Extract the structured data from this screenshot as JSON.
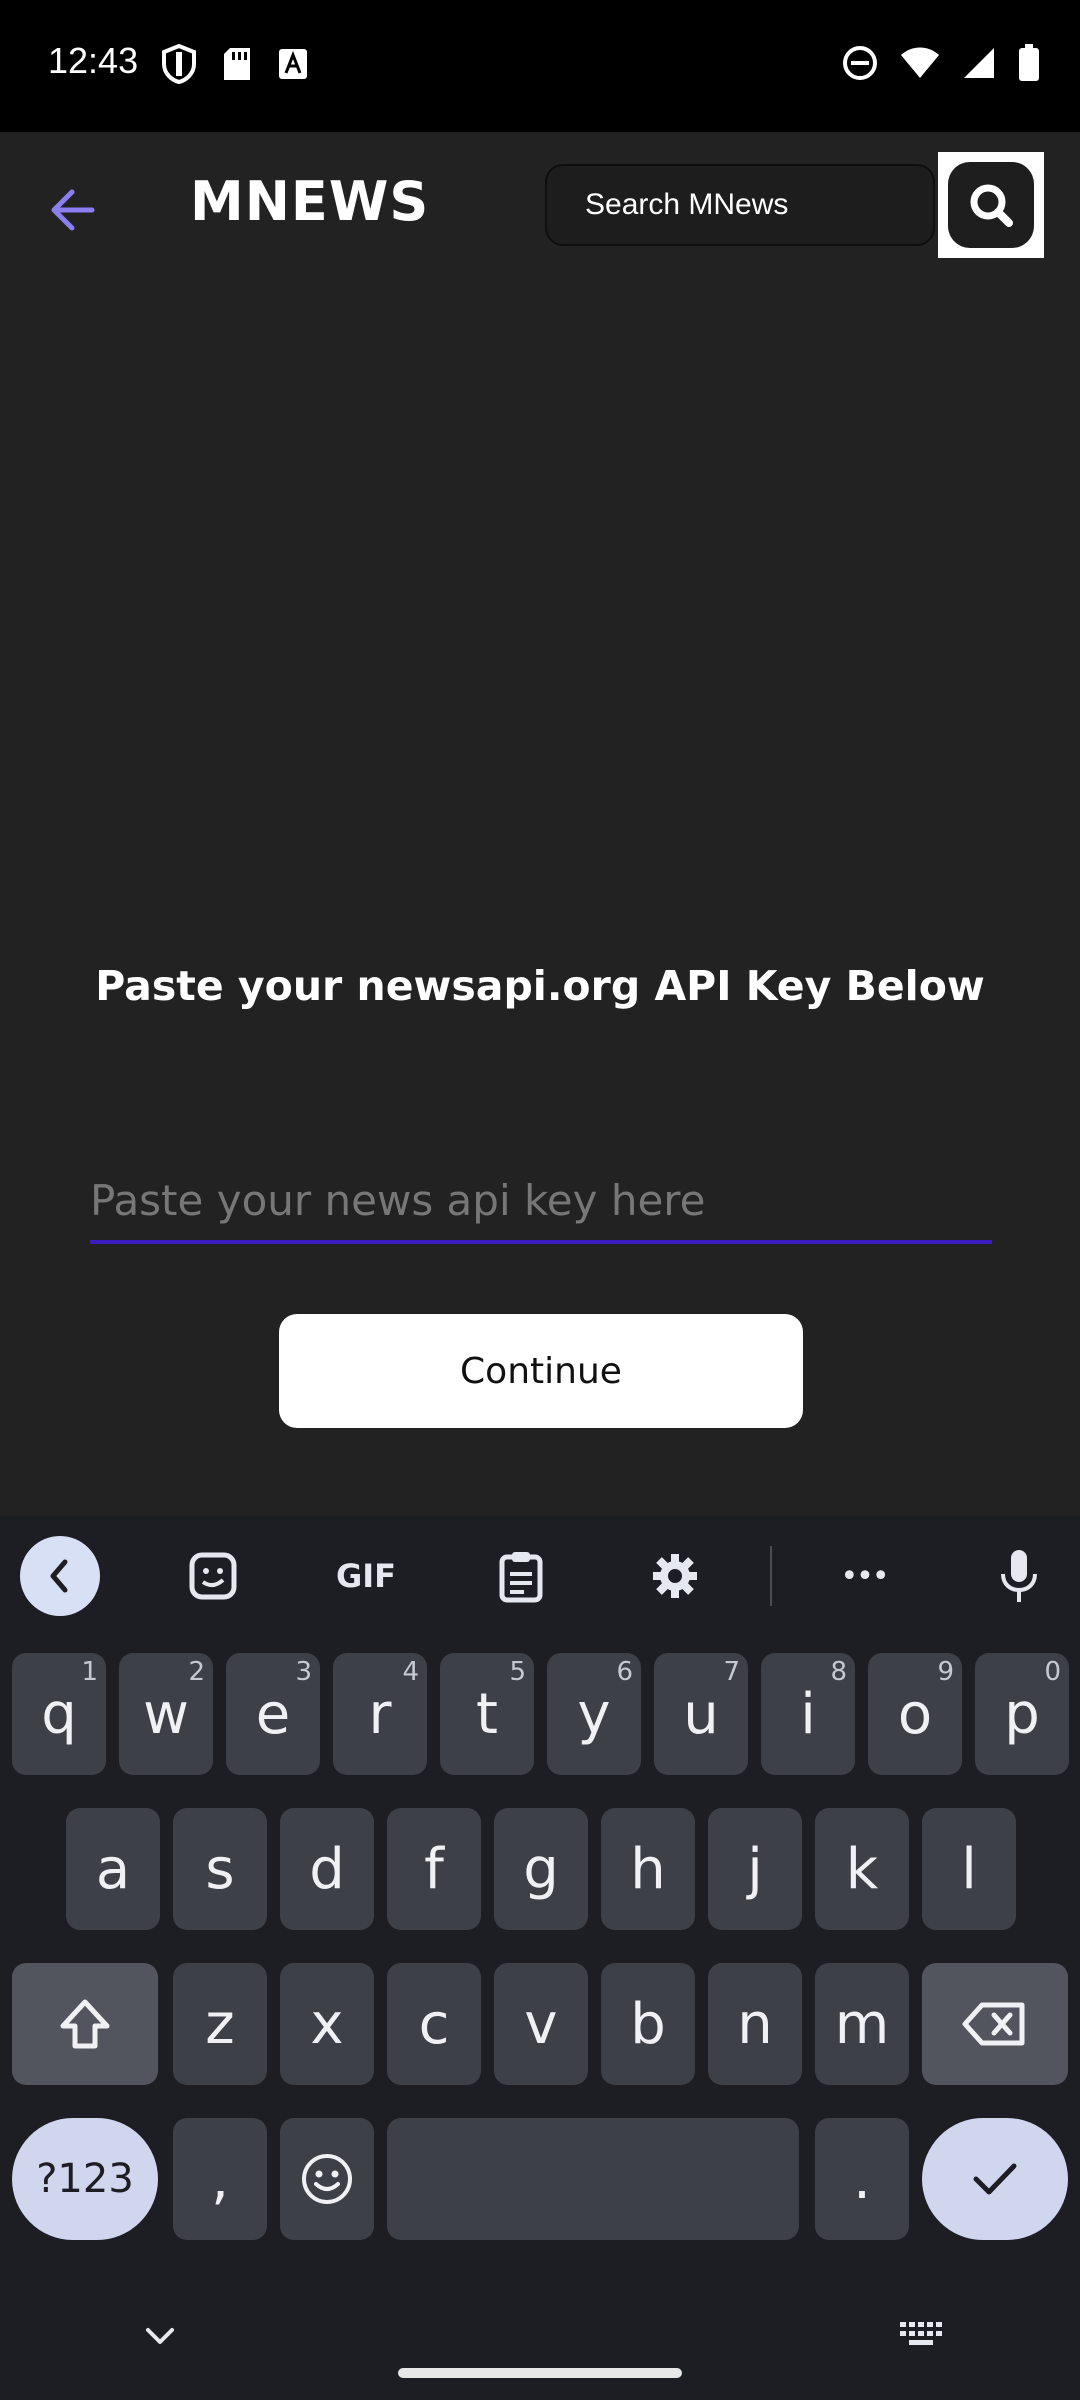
{
  "status_bar": {
    "time": "12:43",
    "left_icons": [
      "shield-icon",
      "sd-card-icon",
      "font-icon"
    ],
    "right_icons": [
      "dnd-icon",
      "wifi-icon",
      "signal-icon",
      "battery-icon"
    ]
  },
  "app_bar": {
    "title": "MNEWS",
    "search_placeholder": "Search MNews",
    "accent_color": "#8b7ff0"
  },
  "main": {
    "prompt": "Paste your newsapi.org API Key Below",
    "api_key_placeholder": "Paste your news api key here",
    "api_key_value": "",
    "continue_label": "Continue"
  },
  "keyboard": {
    "toolbar": [
      "collapse-icon",
      "sticker-icon",
      "gif-icon",
      "clipboard-icon",
      "settings-icon",
      "more-icon",
      "mic-icon"
    ],
    "gif_label": "GIF",
    "more_label": "•••",
    "row1": [
      {
        "k": "q",
        "s": "1"
      },
      {
        "k": "w",
        "s": "2"
      },
      {
        "k": "e",
        "s": "3"
      },
      {
        "k": "r",
        "s": "4"
      },
      {
        "k": "t",
        "s": "5"
      },
      {
        "k": "y",
        "s": "6"
      },
      {
        "k": "u",
        "s": "7"
      },
      {
        "k": "i",
        "s": "8"
      },
      {
        "k": "o",
        "s": "9"
      },
      {
        "k": "p",
        "s": "0"
      }
    ],
    "row2": [
      "a",
      "s",
      "d",
      "f",
      "g",
      "h",
      "j",
      "k",
      "l"
    ],
    "row3": [
      "z",
      "x",
      "c",
      "v",
      "b",
      "n",
      "m"
    ],
    "symbols_label": "?123",
    "comma": ",",
    "period": "."
  }
}
